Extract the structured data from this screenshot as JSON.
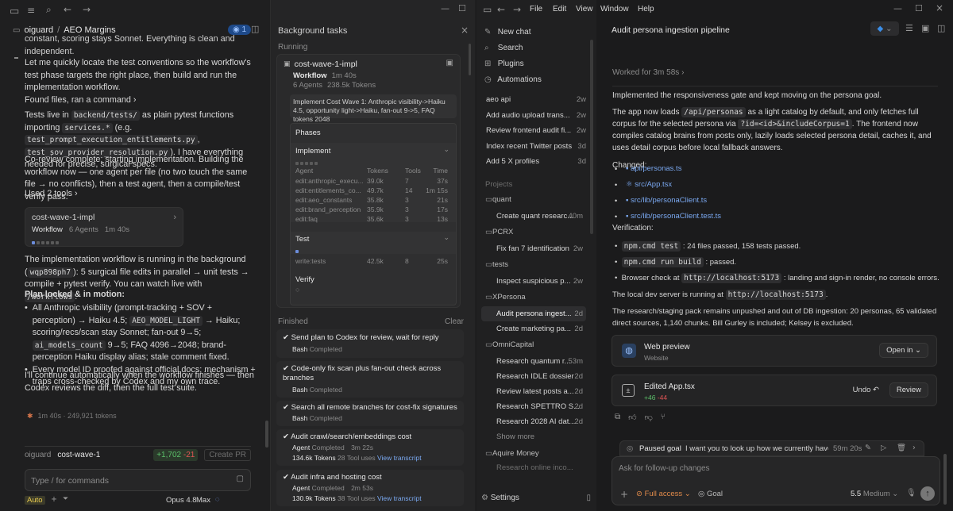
{
  "left": {
    "breadcrumb_project": "oiguard",
    "breadcrumb_sep": "/",
    "breadcrumb_page": "AEO Margins",
    "badge_count": "1",
    "p0": "constant, scoring stays Sonnet. Everything is clean and independent.",
    "p1": "Let me quickly locate the test conventions so the workflow's test phase targets the right place, then build and run the implementation workflow.",
    "found": "Found files, ran a command",
    "p2a": "Tests live in",
    "p2b": "backend/tests/",
    "p2c": "as plain pytest functions importing",
    "p2d": "services.*",
    "p2e": "(e.g.",
    "p2f": "test_prompt_execution_entitlements.py",
    "p2g": "test_sov_provider_resolution.py",
    "p2h": "). I have everything needed for precise, surgical specs.",
    "p3": "Co-review complete; starting implementation. Building the workflow now — one agent per file (no two touch the same file → no conflicts), then a test agent, then a compile/test verify pass.",
    "used": "Used 2 tools",
    "wf_title": "cost-wave-1-impl",
    "wf_label": "Workflow",
    "wf_agents": "6 Agents",
    "wf_time": "1m 40s",
    "p4a": "The implementation workflow is running in the background (",
    "p4b": "wqp898ph7",
    "p4c": "): 5 surgical file edits in parallel → unit tests → compile + pytest verify. You can watch live with",
    "p4d": "/workflows",
    "plan_title": "Plan locked & in motion:",
    "b1a": "All Anthropic visibility (prompt-tracking + SOV + perception) → Haiku 4.5;",
    "b1b": "AEO_MODEL_LIGHT",
    "b1c": "→ Haiku; scoring/recs/scan stay Sonnet; fan-out 9→5;",
    "b1d": "ai_models_count",
    "b1e": "9→5; FAQ 4096→2048; brand-perception Haiku display alias; stale comment fixed.",
    "b2": "Every model ID proofed against official docs; mechanism + traps cross-checked by Codex and my own trace.",
    "p5": "I'll continue automatically when the workflow finishes — then Codex reviews the diff, then the full test suite.",
    "status_line": "1m 40s · 249,921 tokens",
    "branch_user": "oiguard",
    "branch_name": "cost-wave-1",
    "diff_add": "+1,702",
    "diff_del": "-21",
    "create_pr": "Create PR",
    "input_placeholder": "Type / for commands",
    "mode": "Auto",
    "model": "Opus 4.8",
    "effort": "Max"
  },
  "bg": {
    "title": "Background tasks",
    "running": "Running",
    "task_name": "cost-wave-1-impl",
    "task_type": "Workflow",
    "task_time": "1m 40s",
    "task_agents": "6 Agents",
    "task_tokens": "238.5k Tokens",
    "desc": "Implement Cost Wave 1: Anthropic visibility->Haiku 4.5, opportunity light->Haiku, fan-out 9->5, FAQ tokens 2048",
    "phases": "Phases",
    "phase1": "Implement",
    "cols": [
      "Agent",
      "Tokens",
      "Tools",
      "Time"
    ],
    "agents": [
      [
        "edit:anthropic_execu...",
        "39.0k",
        "7",
        "37s"
      ],
      [
        "edit:entitlements_co...",
        "49.7k",
        "14",
        "1m 15s"
      ],
      [
        "edit:aeo_constants",
        "35.8k",
        "3",
        "21s"
      ],
      [
        "edit:brand_perception",
        "35.9k",
        "3",
        "17s"
      ],
      [
        "edit:faq",
        "35.6k",
        "3",
        "13s"
      ]
    ],
    "phase2": "Test",
    "test_row": [
      "write:tests",
      "42.5k",
      "8",
      "25s"
    ],
    "phase3": "Verify",
    "finished": "Finished",
    "clear": "Clear",
    "done": [
      {
        "t": "Send plan to Codex for review, wait for reply",
        "k": "Bash",
        "s": "Completed"
      },
      {
        "t": "Code-only fix scan plus fan-out check across branches",
        "k": "Bash",
        "s": "Completed"
      },
      {
        "t": "Search all remote branches for cost-fix signatures",
        "k": "Bash",
        "s": "Completed"
      },
      {
        "t": "Audit crawl/search/embeddings cost",
        "k": "Agent",
        "s": "Completed",
        "time": "3m 22s",
        "tokens": "134.6k Tokens",
        "tools": "28 Tool uses",
        "link": "View transcript"
      },
      {
        "t": "Audit infra and hosting cost",
        "k": "Agent",
        "s": "Completed",
        "time": "2m 53s",
        "tokens": "130.9k Tokens",
        "tools": "38 Tool uses",
        "link": "View transcript"
      }
    ]
  },
  "right": {
    "menu": [
      "File",
      "Edit",
      "View",
      "Window",
      "Help"
    ],
    "nav": [
      "New chat",
      "Search",
      "Plugins",
      "Automations"
    ],
    "chats": [
      [
        "aeo api",
        "2w"
      ],
      [
        "Add audio upload trans...",
        "2w"
      ],
      [
        "Review frontend audit fi...",
        "2w"
      ],
      [
        "Index recent Twitter posts",
        "3d"
      ],
      [
        "Add 5 X profiles",
        "3d"
      ]
    ],
    "projects_label": "Projects",
    "projects": [
      {
        "name": "quant",
        "items": [
          [
            "Create quant researc...",
            "40m"
          ]
        ]
      },
      {
        "name": "PCRX",
        "items": [
          [
            "Fix fan 7 identification",
            "2w"
          ]
        ]
      },
      {
        "name": "tests",
        "items": [
          [
            "Inspect suspicious p...",
            "2w"
          ]
        ]
      },
      {
        "name": "XPersona",
        "items": [
          [
            "Audit persona ingest...",
            "2d"
          ],
          [
            "Create marketing pa...",
            "2d"
          ]
        ]
      },
      {
        "name": "OmniCapital",
        "items": [
          [
            "Research quantum r...",
            "53m"
          ],
          [
            "Research IDLE dossier",
            "2d"
          ],
          [
            "Review latest posts a...",
            "2d"
          ],
          [
            "Research SPETTRO S...",
            "2d"
          ],
          [
            "Research 2028 AI dat...",
            "2d"
          ]
        ]
      }
    ],
    "show_more": "Show more",
    "aquire": "Aquire Money",
    "aquire_item": "Research online inco...",
    "settings": "Settings",
    "thread_title": "Audit persona ingestion pipeline",
    "worked": "Worked for 3m 58s",
    "m1": "Implemented the responsiveness gate and kept moving on the persona goal.",
    "m2a": "The app now loads",
    "m2b": "/api/personas",
    "m2c": "as a light catalog by default, and only fetches full corpus for the selected persona via",
    "m2d": "?id=<id>&includeCorpus=1",
    "m2e": ". The frontend now compiles catalog brains from posts only, lazily loads selected persona detail, caches it, and uses detail corpus before local fallback answers.",
    "changed": "Changed:",
    "files": [
      "api/personas.ts",
      "src/App.tsx",
      "src/lib/personaClient.ts",
      "src/lib/personaClient.test.ts"
    ],
    "verification": "Verification:",
    "v1a": "npm.cmd test",
    "v1b": ": 24 files passed, 158 tests passed.",
    "v2a": "npm.cmd run build",
    "v2b": ": passed.",
    "v3a": "Browser check at",
    "v3b": "http://localhost:5173",
    "v3c": ": landing and sign-in render, no console errors.",
    "m3a": "The local dev server is running at",
    "m3b": "http://localhost:5173",
    "m3c": ".",
    "m4": "The research/staging pack remains unpushed and out of DB ingestion: 20 personas, 65 validated direct sources, 1,140 chunks. Bill Gurley is included; Kelsey is excluded.",
    "preview_title": "Web preview",
    "preview_sub": "Website",
    "open_in": "Open in",
    "edit_title": "Edited App.tsx",
    "edit_add": "+46",
    "edit_del": "-44",
    "undo": "Undo",
    "review": "Review",
    "paused_label": "Paused goal",
    "paused_text": "I want you to look up how we currently have th...",
    "paused_time": "59m 20s",
    "input_placeholder": "Ask for follow-up changes",
    "access": "Full access",
    "goal": "Goal",
    "model": "5.5",
    "effort": "Medium"
  }
}
